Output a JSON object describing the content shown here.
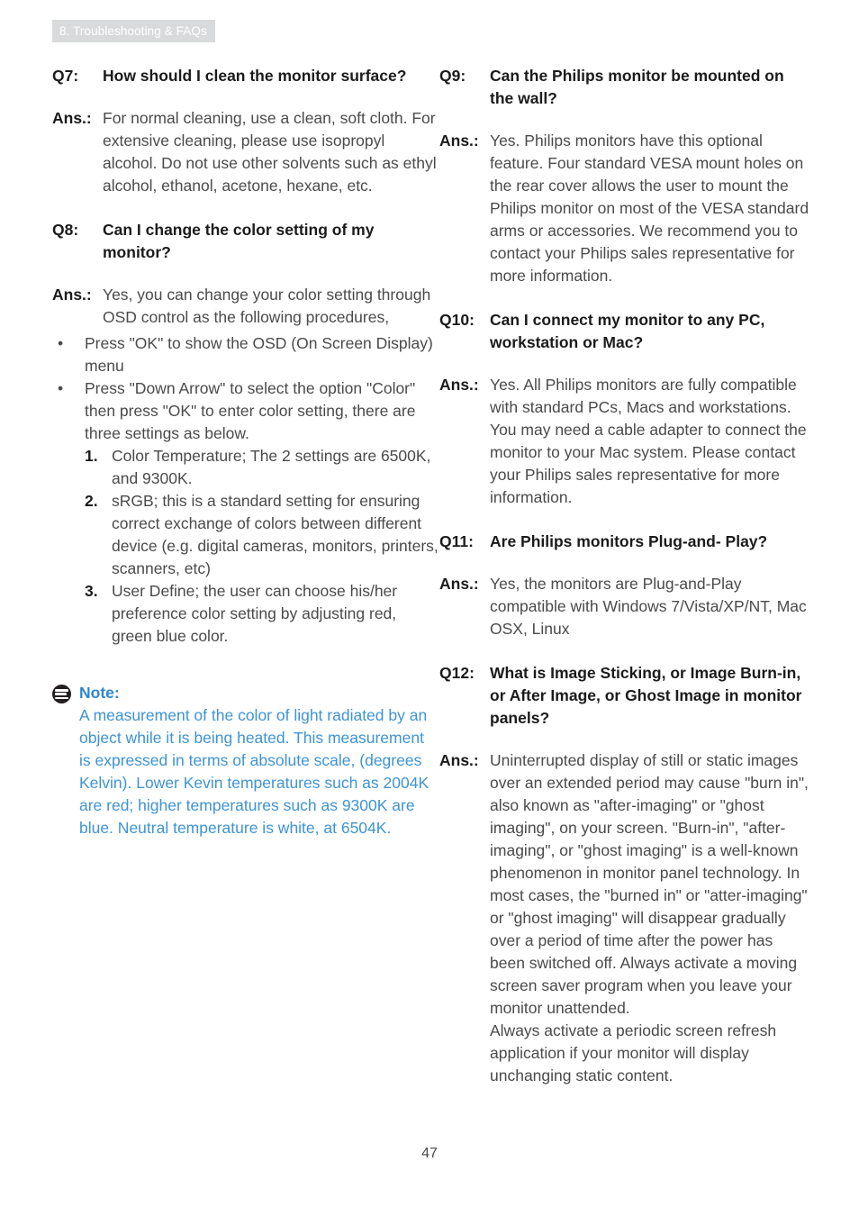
{
  "header": {
    "section_label": "8. Troubleshooting & FAQs",
    "band_color": "#d9dadb",
    "text_color": "#ffffff"
  },
  "footer": {
    "page_number": "47"
  },
  "colors": {
    "body_text": "#4a4a4a",
    "heading_text": "#1b1b1b",
    "note_blue": "#3e93d4",
    "note_title_blue": "#2f87cc",
    "note_icon": "#231f20"
  },
  "labels": {
    "question_q7": "Q7:",
    "question_q8": "Q8:",
    "question_q9": "Q9:",
    "question_q10": "Q10:",
    "question_q11": "Q11:",
    "question_q12": "Q12:",
    "answer": "Ans.:",
    "bullet": "•",
    "num_1": "1.",
    "num_2": "2.",
    "num_3": "3."
  },
  "left_column": {
    "q7": {
      "question": "How should I clean the monitor surface?",
      "answer": "For normal cleaning, use a clean, soft cloth. For extensive cleaning, please use isopropyl alcohol. Do not use other solvents such as ethyl alcohol, ethanol, acetone, hexane, etc."
    },
    "q8": {
      "question": "Can I change the color setting of my monitor?",
      "answer": "Yes, you can change your color setting through OSD control as the following procedures,",
      "bullets": [
        "Press \"OK\" to show the OSD (On Screen Display) menu",
        "Press \"Down Arrow\" to select the option \"Color\" then press \"OK\" to enter color setting, there are three settings as below."
      ],
      "numbered": [
        "Color Temperature; The 2 settings are 6500K, and 9300K.",
        "sRGB; this is a standard setting for ensuring correct exchange of colors between different device (e.g. digital cameras, monitors, printers, scanners, etc)",
        "User Define; the user can choose his/her preference color setting by adjusting red, green blue color."
      ]
    },
    "note": {
      "icon": "note-icon",
      "title": "Note:",
      "body": "A measurement of the color of light radiated by an object while it is being heated. This measurement is expressed in terms of absolute scale, (degrees Kelvin). Lower Kevin temperatures such as 2004K are red; higher temperatures such as 9300K are blue. Neutral temperature is white, at 6504K."
    }
  },
  "right_column": {
    "q9": {
      "question": "Can the Philips monitor be mounted on the wall?",
      "answer": "Yes. Philips monitors have this optional feature. Four standard VESA mount holes on the rear cover allows the user to mount the Philips monitor on most of the VESA standard arms or accessories. We recommend you to contact your Philips sales representative for more information."
    },
    "q10": {
      "question": "Can I connect my monitor to any PC, workstation or Mac?",
      "answer": "Yes. All Philips monitors are fully compatible with standard PCs, Macs and workstations. You may need a cable adapter to connect the monitor to your Mac system. Please contact your Philips sales representative for more information."
    },
    "q11": {
      "question": "Are Philips monitors Plug-and- Play?",
      "answer": "Yes, the monitors are Plug-and-Play compatible with Windows 7/Vista/XP/NT, Mac OSX, Linux"
    },
    "q12": {
      "question": "What is Image Sticking, or Image Burn-in, or After Image, or Ghost Image in monitor panels?",
      "answer_part1": "Uninterrupted display of still or static images over an extended period may cause \"burn in\", also known as \"after-imaging\" or \"ghost imaging\", on your screen. \"Burn-in\", \"after-imaging\", or \"ghost imaging\" is a well-known phenomenon in monitor panel technology. In most cases, the \"burned in\" or \"atter-imaging\" or \"ghost imaging\" will disappear gradually over a period of time after the power has been switched off. Always activate a moving screen saver program when you leave your monitor unattended.",
      "answer_part2": "Always activate a periodic screen refresh application if your monitor will display unchanging static content."
    }
  }
}
